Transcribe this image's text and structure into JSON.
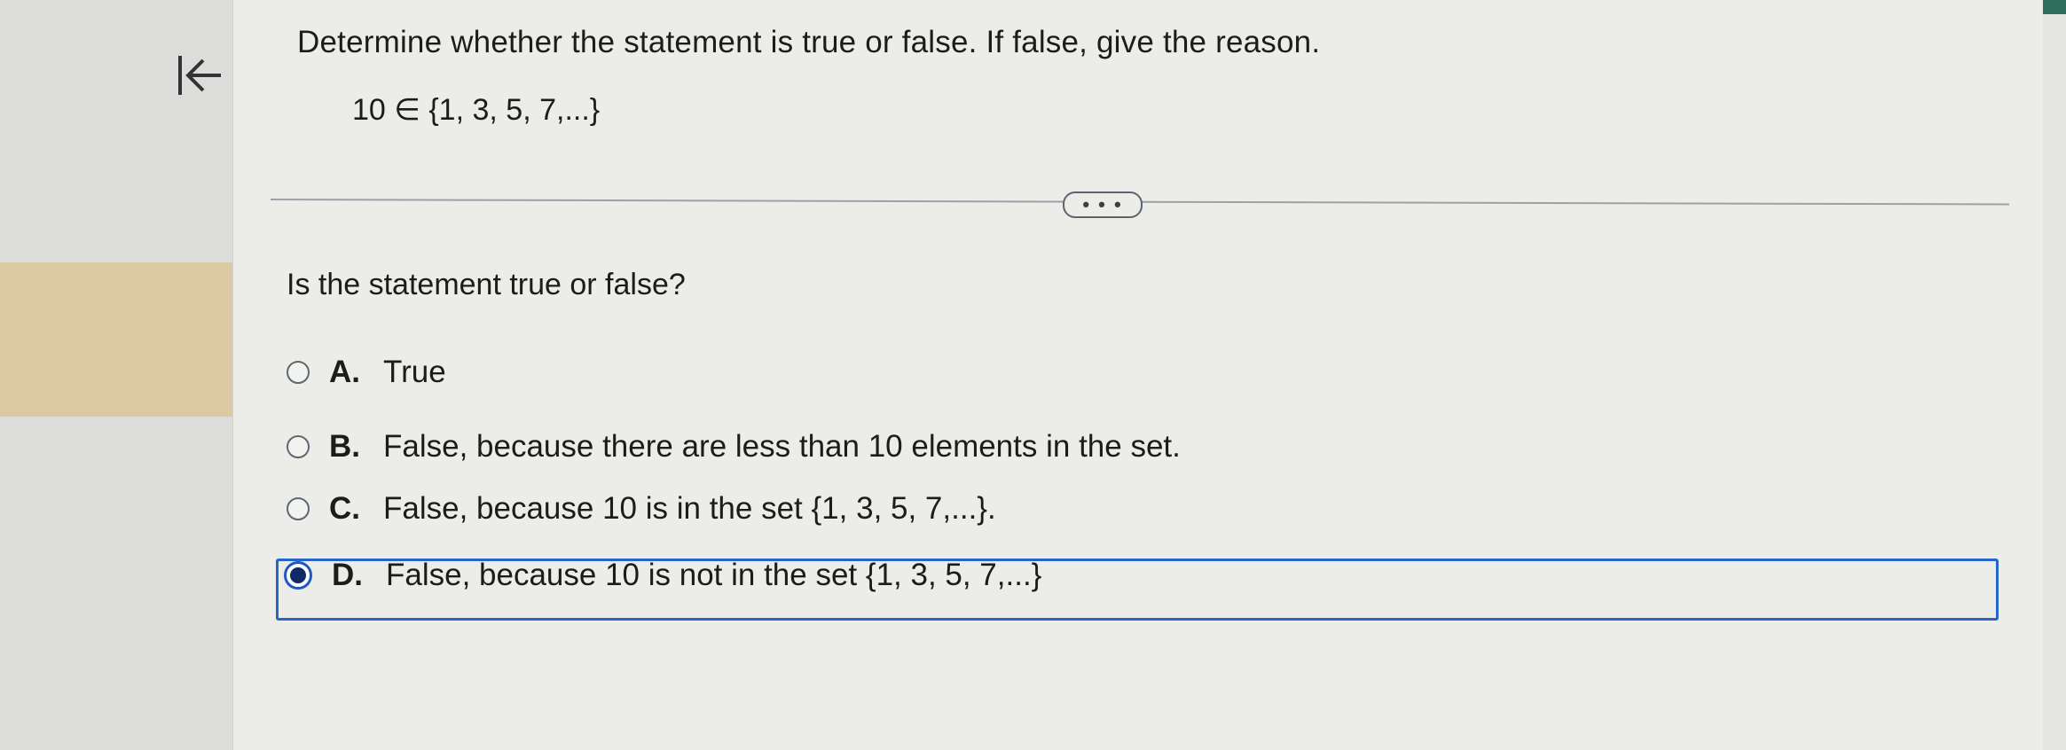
{
  "question": {
    "instruction": "Determine whether the statement is true or false. If false, give the reason.",
    "statement": "10 ∈ {1, 3, 5, 7,...}",
    "prompt": "Is the statement true or false?"
  },
  "more_button": {
    "label": "• • •"
  },
  "options": [
    {
      "letter": "A.",
      "text": "True",
      "selected": false
    },
    {
      "letter": "B.",
      "text": "False, because there are less than 10 elements in the set.",
      "selected": false
    },
    {
      "letter": "C.",
      "text": "False, because 10 is in the set {1, 3, 5, 7,...}.",
      "selected": false
    },
    {
      "letter": "D.",
      "text": "False, because 10 is not in the set {1, 3, 5, 7,...}",
      "selected": true
    }
  ],
  "icons": {
    "collapse": "collapse-left-arrow-icon"
  },
  "colors": {
    "selection_border": "#2766c6",
    "sidebar_highlight": "#dac9a2",
    "top_strip": "#2f6e5d"
  }
}
